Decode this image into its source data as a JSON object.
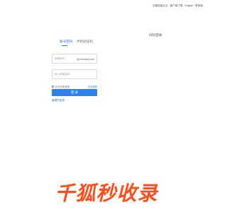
{
  "topbar": {
    "links": [
      "百度网盘企业",
      "客户端下载",
      "English",
      "繁体版"
    ]
  },
  "tabs": [
    {
      "label": "账号密码",
      "active": true
    },
    {
      "label": "手机验证码",
      "active": false
    }
  ],
  "qr_login_label": "扫码登录",
  "username": {
    "placeholder": "邮箱账号",
    "suffix": "@chebada.com"
  },
  "password": {
    "placeholder": "输入邮箱密码"
  },
  "remember_label": "15天内免登录",
  "forgot_label": "忘记密码",
  "login_button": "登 录",
  "admin_link": "管理员登录",
  "brand": {
    "text": "千狐秒收录",
    "color": "#ff4d1a"
  },
  "colors": {
    "accent": "#2f80ed",
    "link": "#2a74d6"
  }
}
